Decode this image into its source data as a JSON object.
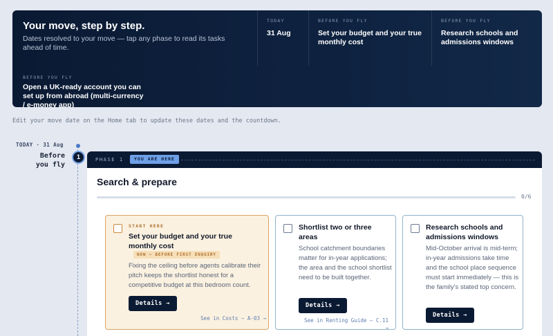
{
  "header": {
    "title": "Your move, step by step.",
    "subtitle": "Dates resolved to your move — tap any phase to read its tasks ahead of time.",
    "columns": [
      {
        "label": "TODAY",
        "value": "31 Aug"
      },
      {
        "label": "BEFORE YOU FLY",
        "value": "Set your budget and your true monthly cost"
      },
      {
        "label": "BEFORE YOU FLY",
        "value": "Research schools and admissions windows"
      }
    ],
    "extra": {
      "label": "BEFORE YOU FLY",
      "value": "Open a UK-ready account you can set up from abroad (multi-currency / e-money app)"
    }
  },
  "note": "Edit your move date on the Home tab to update these dates and the countdown.",
  "timeline": {
    "date_label": "TODAY · 31 Aug",
    "phase_name": "Before you fly",
    "phase_number": "1"
  },
  "phase": {
    "label": "PHASE 1",
    "badge": "YOU ARE HERE",
    "title": "Search & prepare",
    "progress_text": "0/6",
    "progress_fraction": 0
  },
  "tasks": [
    {
      "kicker": "START HERE",
      "title": "Set your budget and your true monthly cost",
      "tag": "NOW — BEFORE FIRST ENQUIRY",
      "description": "Fixing the ceiling before agents calibrate their pitch keeps the shortlist honest for a competitive budget at this bedroom count.",
      "button": "Details →",
      "link": "See in Costs — A-03 →"
    },
    {
      "title": "Shortlist two or three areas",
      "description": "School catchment boundaries matter for in-year applications; the area and the school shortlist need to be built together.",
      "button": "Details →",
      "link": "See in Renting Guide — C.11 →"
    },
    {
      "title": "Research schools and admissions windows",
      "description": "Mid-October arrival is mid-term; in-year admissions take time and the school place sequence must start immediately — this is the family's stated top concern.",
      "button": "Details →"
    }
  ]
}
